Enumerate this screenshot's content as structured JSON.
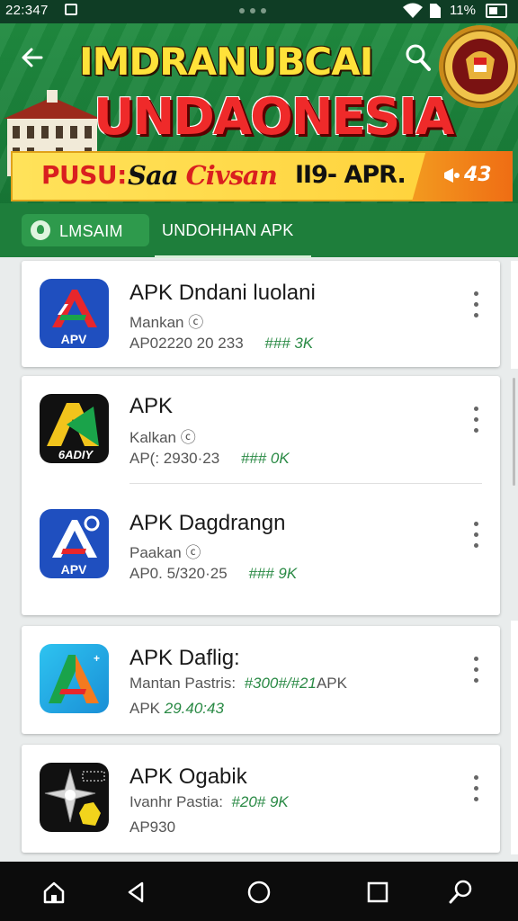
{
  "status_bar": {
    "time": "22:347",
    "battery": "11%"
  },
  "header": {
    "title_line1": "IMDRANUBCAI",
    "title_line2": "UNDAONESIA",
    "promo_label": "PUSU:",
    "promo_name_a": "Saa ",
    "promo_name_b": "Civsan",
    "promo_date": " II9- APR.",
    "badge_count": "43"
  },
  "tabs": [
    {
      "label": "LMSAIM",
      "active": true
    },
    {
      "label": "UNDOHHAN APK",
      "active": false
    }
  ],
  "apps": [
    {
      "name": "APK Dndani luolani",
      "sub": "Mankan ⓒ",
      "meta": "AP02220 20 233",
      "meta_green": "### 3K",
      "icon": "red-a-icon",
      "icon_text": "APV"
    },
    {
      "name": "APK",
      "sub": "Kalkan ⓒ",
      "meta": "AP(: 2930·23",
      "meta_green": "### 0K",
      "icon": "gold-a-icon",
      "icon_text": "6ADIY"
    },
    {
      "name": "APK Dagdrangn",
      "sub": "Paakan ⓒ",
      "meta": "AP0. 5/320·25",
      "meta_green": "### 9K",
      "icon": "blue-a-icon",
      "icon_text": "APV"
    },
    {
      "name": "APK Daflig:",
      "sub": "Mantan Pastris:",
      "sub_green": "#300#/#21",
      "sub_tail": "APK",
      "meta": "APK",
      "meta_green": "29.40:43",
      "icon": "gradient-a-icon"
    },
    {
      "name": "APK Ogabik",
      "sub": "Ivanhr Pastia:",
      "sub_green": "#20# 9K",
      "meta": "AP930",
      "icon": "star-icon"
    }
  ],
  "colors": {
    "header_green": "#1f8a3f",
    "title_yellow": "#ffe23a",
    "title_red": "#ef2a2a",
    "accent_green": "#2a8a45"
  }
}
